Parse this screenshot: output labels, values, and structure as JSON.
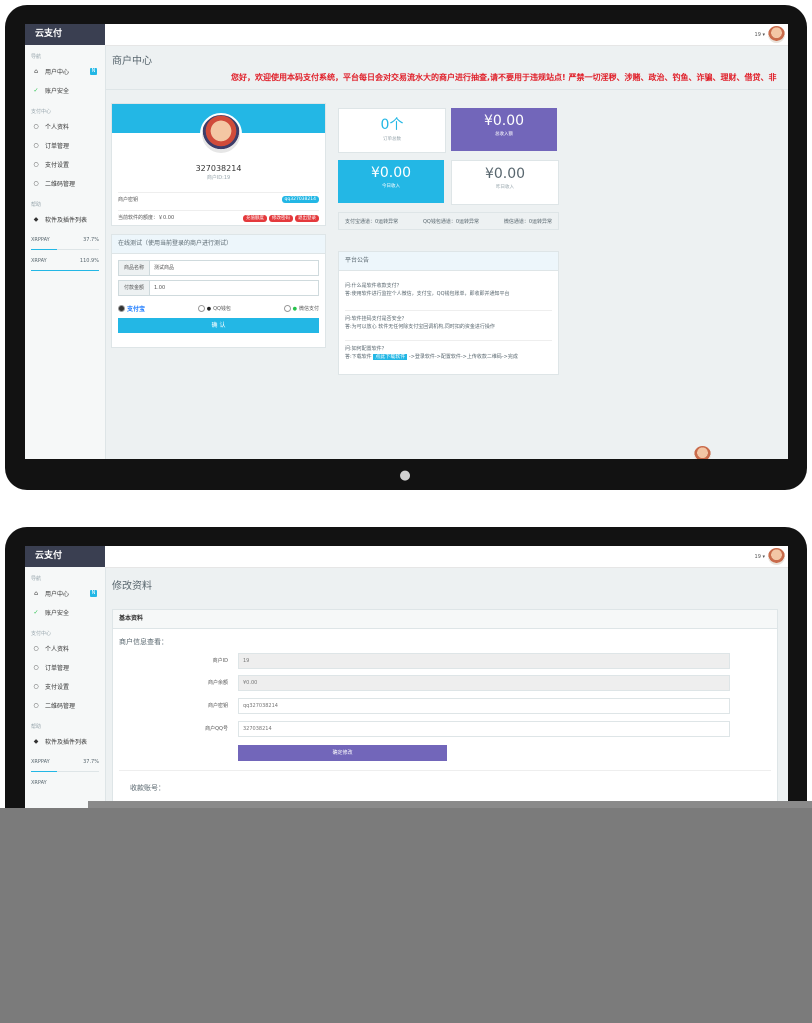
{
  "brand": "云支付",
  "notice": "您好，欢迎使用本码支付系统，平台每日会对交易流水大的商户进行抽查,请不要用于违规站点! 严禁一切淫秽、涉赌、政治、钓鱼、诈骗、理财、借贷、非",
  "user_label": "19 ▾",
  "sidebar": {
    "sec_nav": "导航",
    "items_top": [
      {
        "label": "用户中心",
        "icon": "home-icon"
      },
      {
        "label": "账户安全",
        "icon": "leaf-icon"
      }
    ],
    "sec_pay": "支付中心",
    "items_pay": [
      {
        "label": "个人资料",
        "icon": "dot-icon"
      },
      {
        "label": "订单管理",
        "icon": "dot-icon"
      },
      {
        "label": "支付设置",
        "icon": "dot-icon"
      },
      {
        "label": "二维码管理",
        "icon": "dot-icon"
      }
    ],
    "sec_help": "帮助",
    "items_help": [
      {
        "label": "软件及插件列表",
        "icon": "gem-icon"
      }
    ],
    "progress": [
      {
        "label": "XRPPAY",
        "value": "37.7%",
        "fraction": 0.377
      },
      {
        "label": "XRPAY",
        "value": "110.9%",
        "fraction": 1.0
      }
    ]
  },
  "screen1": {
    "title": "商户中心",
    "profile": {
      "uid": "327038214",
      "sub": "商户ID:19",
      "key_label": "商户密钥",
      "key_tag": "qq327038214",
      "balance_label": "当前软件的额度：￥0.00",
      "btn1": "充值额度",
      "btn2": "修改密码",
      "btn3": "退出登录"
    },
    "test": {
      "title": "在线测试（使用当前登录的商户进行测试）",
      "name_label": "商品名称",
      "name_value": "测试商品",
      "amount_label": "付款金额",
      "amount_value": "1.00",
      "pay1": "支付宝",
      "pay2": "QQ钱包",
      "pay3": "微信支付",
      "submit": "确 认"
    },
    "stats": [
      {
        "value": "0个",
        "label": "订单总数"
      },
      {
        "value": "¥0.00",
        "label": "总收入额"
      },
      {
        "value": "¥0.00",
        "label": "今日收入"
      },
      {
        "value": "¥0.00",
        "label": "昨日收入"
      }
    ],
    "channels": [
      "支付宝通道：0运转异常",
      "QQ钱包通道：0运转异常",
      "微信通道：0运转异常"
    ],
    "announce": {
      "title": "平台公告",
      "q1": "问:什么是软件收款支付？",
      "a1": "答:使用软件进行监控个人微信，支付宝，QQ钱包账单，即收即并通知平台",
      "q2": "问:软件挂码支付是否安全？",
      "a2": "答:为可以放心 软件无任何除支付宝回调机构,同时扣的资金进行操作",
      "q3": "问:如何配置软件？",
      "a3_pre": "答:下载软件 ",
      "a3_hl": "点此下载软件",
      "a3_post": " ->登录软件->配置软件->上传收款二维码->完成"
    }
  },
  "screen2": {
    "title": "修改资料",
    "section": "基本资料",
    "subhead": "商户信息查看：",
    "fields": [
      {
        "label": "商户ID",
        "value": "19"
      },
      {
        "label": "商户余额",
        "value": "¥0.00"
      },
      {
        "label": "商户密钥",
        "value": "qq327038214"
      },
      {
        "label": "商户QQ号",
        "value": "327038214"
      }
    ],
    "submit": "确定修改",
    "account_head": "收款账号："
  }
}
